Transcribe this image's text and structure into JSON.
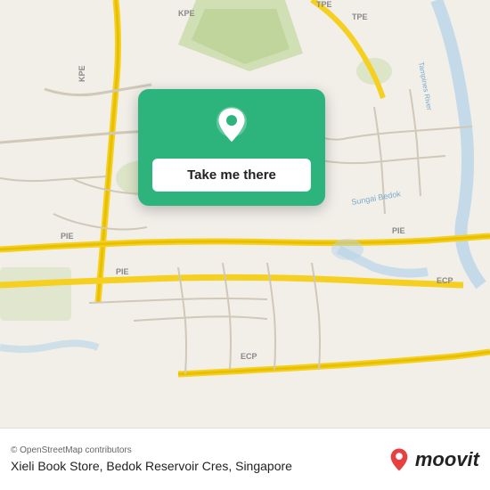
{
  "map": {
    "attribution": "© OpenStreetMap contributors",
    "background_color": "#e8e0d0"
  },
  "card": {
    "take_me_there_label": "Take me there",
    "pin_icon": "location-pin"
  },
  "bottom_bar": {
    "attribution": "© OpenStreetMap contributors",
    "location_name": "Xieli Book Store, Bedok Reservoir Cres, Singapore",
    "moovit_label": "moovit"
  }
}
